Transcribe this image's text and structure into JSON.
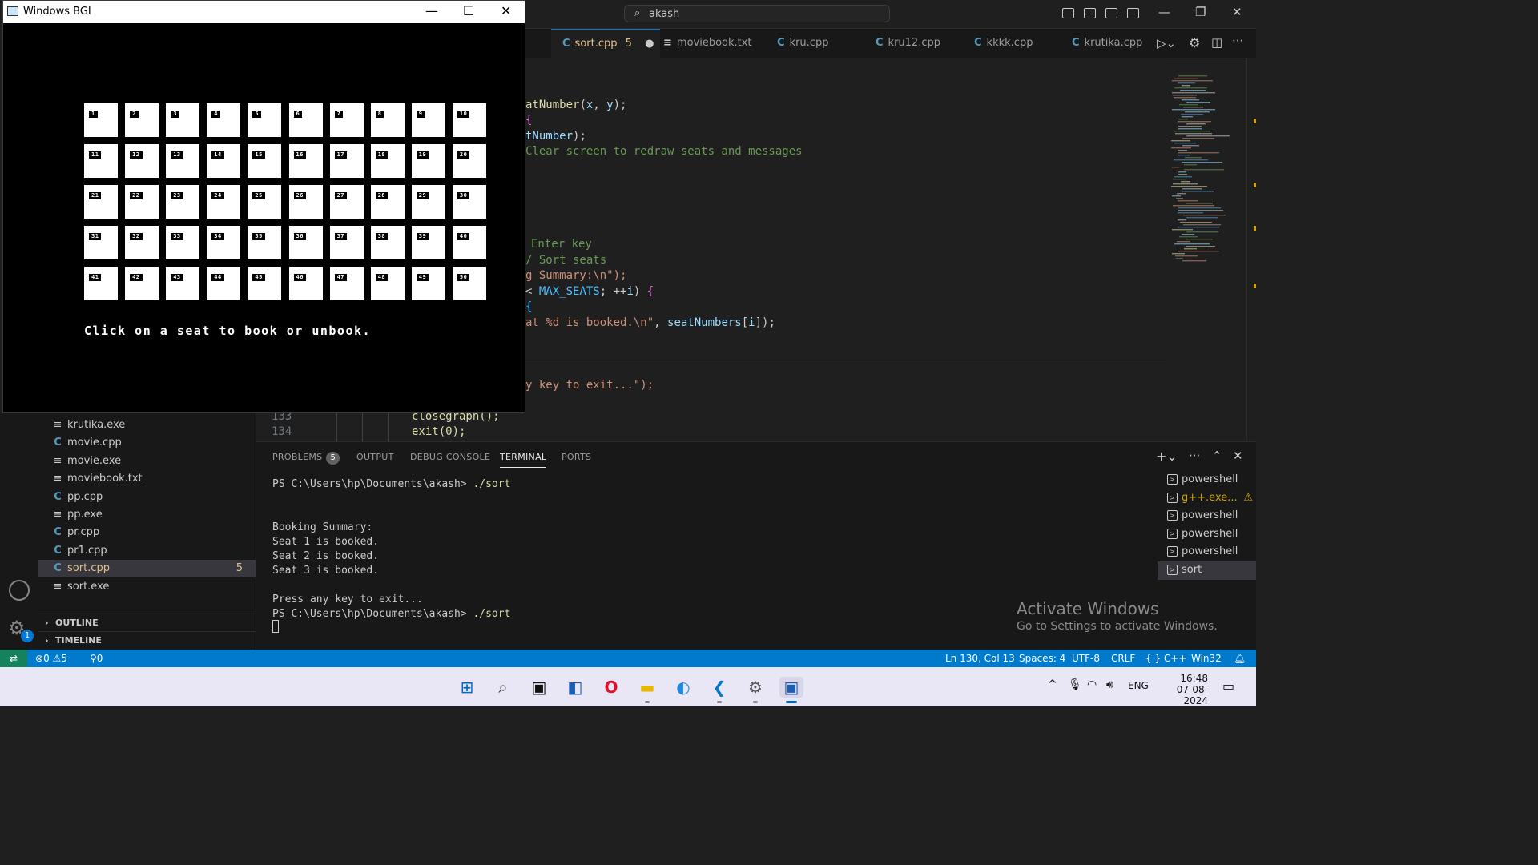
{
  "vscode": {
    "search_text": "akash",
    "tabs": [
      {
        "name": "sort.cpp",
        "badge": "5",
        "modified": true,
        "active": true,
        "icon": "cpp-file-icon"
      },
      {
        "name": "moviebook.txt",
        "active": false,
        "icon": "text-file-icon"
      },
      {
        "name": "kru.cpp",
        "active": false,
        "icon": "cpp-file-icon"
      },
      {
        "name": "kru12.cpp",
        "active": false,
        "icon": "cpp-file-icon"
      },
      {
        "name": "kkkk.cpp",
        "active": false,
        "icon": "cpp-file-icon"
      },
      {
        "name": "krutika.cpp",
        "active": false,
        "icon": "cpp-file-icon"
      }
    ],
    "code_lines": [
      {
        "a": "atNumber(x, y);"
      },
      {
        "a": "{"
      },
      {
        "a": "tNumber);"
      },
      {
        "a": "Clear screen to redraw seats and messages"
      },
      {
        "a": "Enter key"
      },
      {
        "a": "/ Sort seats"
      },
      {
        "a": "g Summary:\\n\");"
      },
      {
        "a": "< MAX_SEATS; ++i) {"
      },
      {
        "a": "{"
      },
      {
        "a": "at %d is booked.\\n\", seatNumbers[i]);"
      },
      {
        "a": "y key to exit...\");"
      }
    ],
    "visible_code_lower": [
      {
        "num": "133",
        "text": "closegraph();"
      },
      {
        "num": "134",
        "text": "exit(0);"
      }
    ],
    "explorer_files": [
      {
        "name": "krutika.exe",
        "icon": "file-lines-icon"
      },
      {
        "name": "movie.cpp",
        "icon": "cpp-file-icon"
      },
      {
        "name": "movie.exe",
        "icon": "file-lines-icon"
      },
      {
        "name": "moviebook.txt",
        "icon": "file-lines-icon"
      },
      {
        "name": "pp.cpp",
        "icon": "cpp-file-icon"
      },
      {
        "name": "pp.exe",
        "icon": "file-lines-icon"
      },
      {
        "name": "pr.cpp",
        "icon": "cpp-file-icon"
      },
      {
        "name": "pr1.cpp",
        "icon": "cpp-file-icon"
      },
      {
        "name": "sort.cpp",
        "icon": "cpp-file-icon",
        "selected": true,
        "badge": "5"
      },
      {
        "name": "sort.exe",
        "icon": "file-lines-icon"
      }
    ],
    "sections": [
      "OUTLINE",
      "TIMELINE"
    ],
    "panel_tabs": [
      {
        "label": "PROBLEMS",
        "count": "5"
      },
      {
        "label": "OUTPUT"
      },
      {
        "label": "DEBUG CONSOLE"
      },
      {
        "label": "TERMINAL",
        "active": true
      },
      {
        "label": "PORTS"
      }
    ],
    "terminal_lines": [
      "PS C:\\Users\\hp\\Documents\\akash> ./sort",
      "",
      "",
      "Booking Summary:",
      "Seat 1 is booked.",
      "Seat 2 is booked.",
      "Seat 3 is booked.",
      "",
      "Press any key to exit...",
      "PS C:\\Users\\hp\\Documents\\akash> ./sort"
    ],
    "terminals": [
      {
        "name": "powershell"
      },
      {
        "name": "g++.exe...",
        "warning": true
      },
      {
        "name": "powershell"
      },
      {
        "name": "powershell"
      },
      {
        "name": "powershell"
      },
      {
        "name": "sort",
        "selected": true
      }
    ],
    "activate": {
      "title": "Activate Windows",
      "sub": "Go to Settings to activate Windows."
    },
    "status": {
      "errors": "0",
      "warnings": "5",
      "ports": "0",
      "position": "Ln 130, Col 13",
      "spaces": "Spaces: 4",
      "encoding": "UTF-8",
      "eol": "CRLF",
      "language": "C++",
      "platform": "Win32"
    },
    "accounts_badge": "1"
  },
  "bgi": {
    "title": "Windows BGI",
    "message": "Click on a seat to book or unbook.",
    "seats": [
      "1",
      "2",
      "3",
      "4",
      "5",
      "6",
      "7",
      "8",
      "9",
      "10",
      "11",
      "12",
      "13",
      "14",
      "15",
      "16",
      "17",
      "18",
      "19",
      "20",
      "21",
      "22",
      "23",
      "24",
      "25",
      "26",
      "27",
      "28",
      "29",
      "30",
      "31",
      "32",
      "33",
      "34",
      "35",
      "36",
      "37",
      "38",
      "39",
      "40",
      "41",
      "42",
      "43",
      "44",
      "45",
      "46",
      "47",
      "48",
      "49",
      "50"
    ]
  },
  "taskbar": {
    "time": "16:48",
    "date": "07-08-2024",
    "lang": "ENG"
  }
}
